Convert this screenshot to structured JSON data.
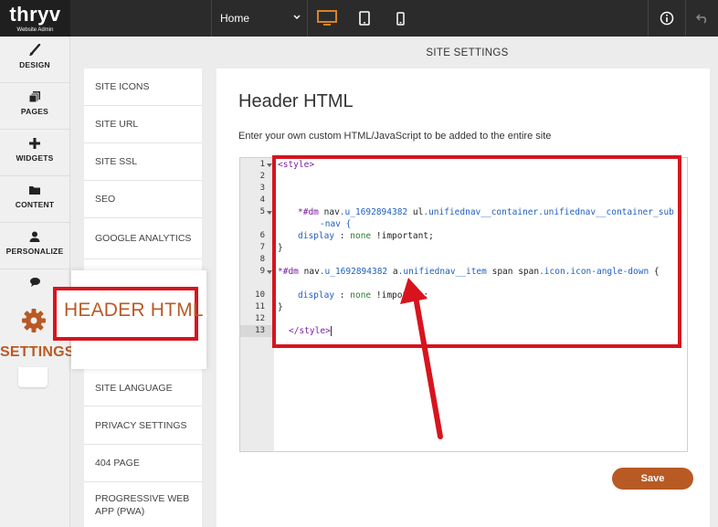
{
  "brand": {
    "name": "thryv",
    "subtitle": "Website Admin"
  },
  "topbar": {
    "page_select": "Home",
    "devices": [
      "desktop-icon",
      "tablet-icon",
      "mobile-icon"
    ],
    "active_device": "desktop",
    "accent": "#d9822b"
  },
  "rail": {
    "items": [
      {
        "label": "DESIGN",
        "icon": "brush-icon"
      },
      {
        "label": "PAGES",
        "icon": "pages-icon"
      },
      {
        "label": "WIDGETS",
        "icon": "plus-icon"
      },
      {
        "label": "CONTENT",
        "icon": "folder-icon"
      },
      {
        "label": "PERSONALIZE",
        "icon": "user-icon"
      }
    ],
    "settings_label": "SETTINGS"
  },
  "main": {
    "title": "SITE SETTINGS"
  },
  "submenu": {
    "items": [
      "SITE ICONS",
      "SITE URL",
      "SITE SSL",
      "SEO",
      "GOOGLE ANALYTICS",
      "SITE LANGUAGE",
      "PRIVACY SETTINGS",
      "404 PAGE",
      "PROGRESSIVE WEB APP (PWA)"
    ],
    "highlighted": "HEADER HTML"
  },
  "panel": {
    "title": "Header HTML",
    "description": "Enter your own custom HTML/JavaScript to be added to the entire site",
    "save_label": "Save"
  },
  "editor": {
    "line_numbers": [
      "1",
      "2",
      "3",
      "4",
      "5",
      "6",
      "7",
      "8",
      "9",
      "10",
      "11",
      "12",
      "13"
    ],
    "code": {
      "l1": "<style>",
      "l5a": "*#dm",
      "l5b": "nav",
      "l5c": ".u_1692894382",
      "l5d": "ul",
      "l5e": ".unifiednav__container.unifiednav__container_sub",
      "l5f": "-nav {",
      "l6a": "display",
      "l6b": ":",
      "l6c": "none",
      "l6d": "!important;",
      "l7": "}",
      "l9a": "*#dm",
      "l9b": "nav",
      "l9c": ".u_1692894382",
      "l9d": "a",
      "l9e": ".unifiednav__item",
      "l9f": "span span",
      "l9g": ".icon.icon-angle-down",
      "l9h": "{",
      "l10a": "display",
      "l10b": ":",
      "l10c": "none",
      "l10d": "!impo",
      "l10e": "tant;",
      "l11": "}",
      "l13": "</style>"
    }
  },
  "colors": {
    "highlight": "#d7141e",
    "brand_orange": "#b85a24"
  }
}
